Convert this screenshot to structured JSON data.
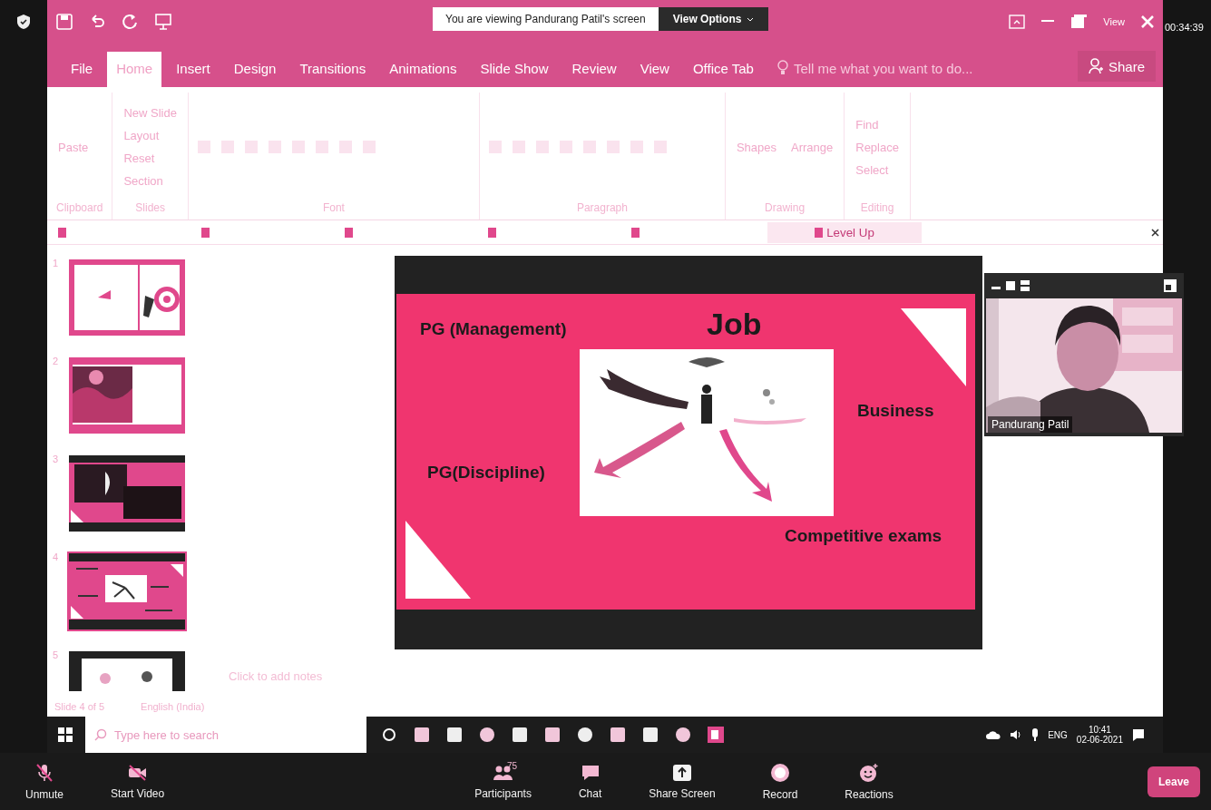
{
  "zoom_top": {
    "banner": "You are viewing Pandurang Patil's screen",
    "view_options": "View Options",
    "view": "View",
    "timer": "00:34:39"
  },
  "ribbon_tabs": [
    {
      "label": "File",
      "selected": false
    },
    {
      "label": "Home",
      "selected": true
    },
    {
      "label": "Insert",
      "selected": false
    },
    {
      "label": "Design",
      "selected": false
    },
    {
      "label": "Transitions",
      "selected": false
    },
    {
      "label": "Animations",
      "selected": false
    },
    {
      "label": "Slide Show",
      "selected": false
    },
    {
      "label": "Review",
      "selected": false
    },
    {
      "label": "View",
      "selected": false
    },
    {
      "label": "Office Tab",
      "selected": false
    }
  ],
  "tell_me": "Tell me what you want to do...",
  "share": "Share",
  "ribbon_groups": [
    {
      "label": "Clipboard",
      "commands": [
        "Paste"
      ]
    },
    {
      "label": "Slides",
      "commands": [
        "New Slide",
        "Layout",
        "Reset",
        "Section"
      ]
    },
    {
      "label": "Font"
    },
    {
      "label": "Paragraph"
    },
    {
      "label": "Drawing",
      "commands": [
        "Shapes",
        "Arrange"
      ]
    },
    {
      "label": "Editing",
      "commands": [
        "Find",
        "Replace",
        "Select"
      ]
    }
  ],
  "doc_tabs": [
    {
      "selected": false
    },
    {
      "selected": false
    },
    {
      "selected": false
    },
    {
      "selected": false
    },
    {
      "selected": false
    },
    {
      "label": "Level Up",
      "selected": true
    }
  ],
  "thumbnails": [
    {
      "number": "1",
      "kind": "title",
      "selected": false
    },
    {
      "number": "2",
      "selected": false
    },
    {
      "number": "3",
      "kind": "dark",
      "selected": false
    },
    {
      "number": "4",
      "kind": "diagram",
      "selected": true
    },
    {
      "number": "5",
      "kind": "partial",
      "selected": false
    }
  ],
  "slide": {
    "title": "Job",
    "labels": [
      "PG (Management)",
      "Business",
      "PG(Discipline)",
      "Competitive exams"
    ]
  },
  "video": {
    "name": "Pandurang Patil"
  },
  "notes_placeholder": "Click to add notes",
  "status": [
    "Slide 4 of 5",
    "English (India)"
  ],
  "taskbar": {
    "search_placeholder": "Type here to search",
    "language": "ENG",
    "time": "10:41",
    "date": "02-06-2021"
  },
  "zoom_controls": [
    {
      "label": "Unmute",
      "kind": "mic"
    },
    {
      "label": "Start Video",
      "kind": "video"
    },
    {
      "label": "Participants",
      "kind": "participants",
      "count": "75"
    },
    {
      "label": "Chat",
      "kind": "chat"
    },
    {
      "label": "Share Screen",
      "kind": "share"
    },
    {
      "label": "Record",
      "kind": "record"
    },
    {
      "label": "Reactions",
      "kind": "reactions"
    }
  ],
  "leave": "Leave"
}
